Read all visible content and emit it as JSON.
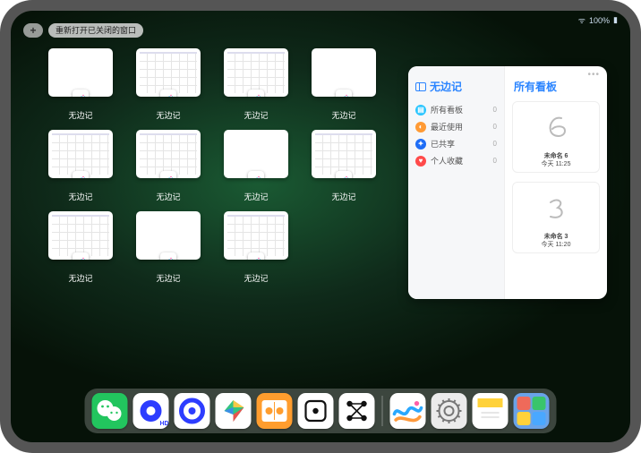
{
  "status": {
    "signal": "ᯤ",
    "battery": "100%",
    "batt_icon": "▮"
  },
  "topbar": {
    "plus": "+",
    "reopen_label": "重新打开已关闭的窗口"
  },
  "app_name": "无边记",
  "thumbs": [
    {
      "kind": "blank"
    },
    {
      "kind": "cal"
    },
    {
      "kind": "cal"
    },
    {
      "kind": "blank"
    },
    {
      "kind": "cal"
    },
    {
      "kind": "cal"
    },
    {
      "kind": "blank"
    },
    {
      "kind": "cal"
    },
    {
      "kind": "cal"
    },
    {
      "kind": "blank"
    },
    {
      "kind": "cal"
    },
    {
      "kind": "hidden"
    }
  ],
  "panel": {
    "left_title": "无边记",
    "categories": [
      {
        "color": "#29c5ff",
        "glyph": "▤",
        "label": "所有看板",
        "count": 0
      },
      {
        "color": "#ff9a34",
        "glyph": "◐",
        "label": "最近使用",
        "count": 0
      },
      {
        "color": "#1e6df6",
        "glyph": "✦",
        "label": "已共享",
        "count": 0
      },
      {
        "color": "#ff4a4a",
        "glyph": "♥",
        "label": "个人收藏",
        "count": 0
      }
    ],
    "right_title": "所有看板",
    "more": "•••",
    "boards": [
      {
        "scribble": "6",
        "name": "未命名 6",
        "time": "今天 11:25"
      },
      {
        "scribble": "3",
        "name": "未命名 3",
        "time": "今天 11:20"
      }
    ]
  },
  "dock": [
    {
      "name": "wechat",
      "bg": "#22c55e"
    },
    {
      "name": "quark-hd",
      "bg": "#ffffff"
    },
    {
      "name": "quark",
      "bg": "#ffffff"
    },
    {
      "name": "play",
      "bg": "#ffffff"
    },
    {
      "name": "books",
      "bg": "#ff9d2e"
    },
    {
      "name": "dice",
      "bg": "#ffffff"
    },
    {
      "name": "graph",
      "bg": "#ffffff"
    },
    {
      "name": "sep"
    },
    {
      "name": "freeform",
      "bg": "#ffffff"
    },
    {
      "name": "settings",
      "bg": "#ebebeb"
    },
    {
      "name": "notes",
      "bg": "#ffffff"
    },
    {
      "name": "folder",
      "bg": "#6aa3e8"
    }
  ]
}
